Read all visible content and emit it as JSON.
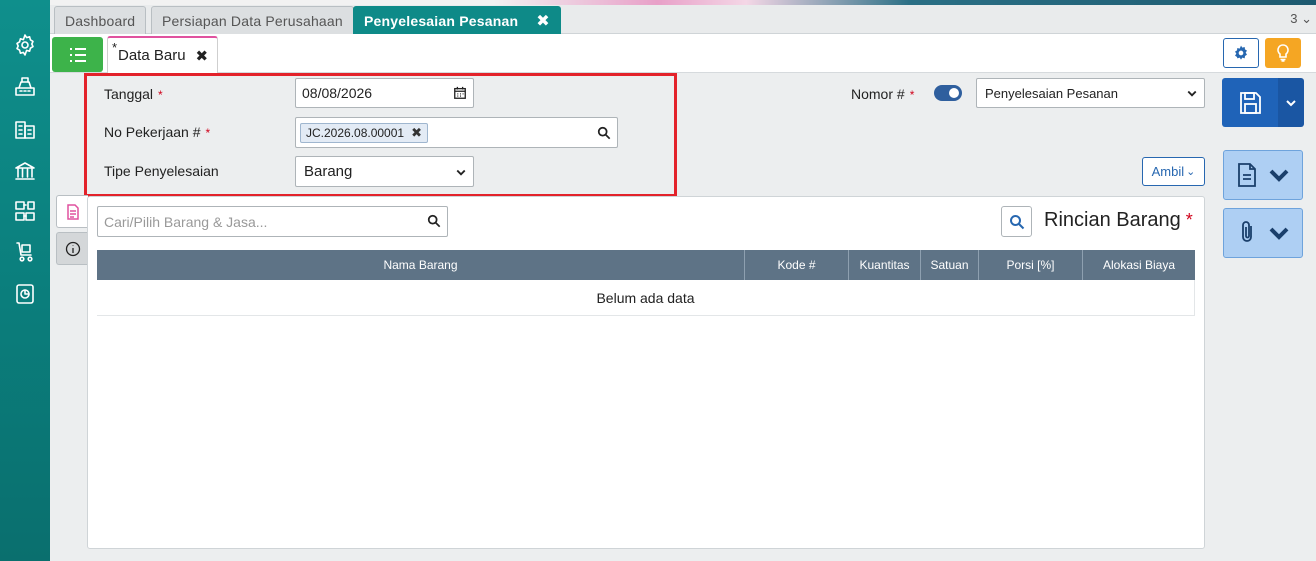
{
  "tabs": [
    {
      "label": "Dashboard",
      "active": false
    },
    {
      "label": "Persiapan Data Perusahaan",
      "active": false
    },
    {
      "label": "Penyelesaian Pesanan",
      "active": true
    }
  ],
  "tab_count": "3",
  "doc_tab": {
    "modified_marker": "*",
    "label": "Data Baru"
  },
  "form": {
    "tanggal": {
      "label": "Tanggal",
      "required": "*",
      "value": "08/08/2026"
    },
    "no_pekerjaan": {
      "label": "No Pekerjaan #",
      "required": "*",
      "chip": "JC.2026.08.00001"
    },
    "tipe": {
      "label": "Tipe Penyelesaian",
      "value": "Barang"
    },
    "nomor": {
      "label": "Nomor #",
      "required": "*",
      "value": "Penyelesaian Pesanan"
    }
  },
  "ambil_label": "Ambil",
  "detail": {
    "search_placeholder": "Cari/Pilih Barang & Jasa...",
    "title": "Rincian Barang",
    "required": "*",
    "columns": [
      "Nama Barang",
      "Kode #",
      "Kuantitas",
      "Satuan",
      "Porsi [%]",
      "Alokasi Biaya"
    ],
    "empty_text": "Belum ada data"
  },
  "colors": {
    "sidebar": "#0e8a88",
    "active_tab": "#0e8a88",
    "list_button": "#3db34a",
    "save_button": "#1f63b8",
    "highlight": "#e3222a",
    "grid_header": "#5e7386",
    "bulb": "#f5a623"
  }
}
